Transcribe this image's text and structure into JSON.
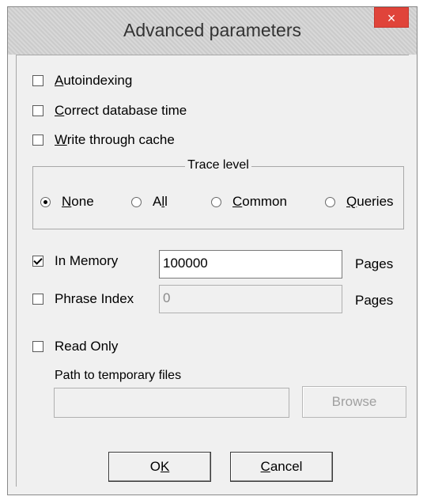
{
  "window": {
    "title": "Advanced parameters",
    "close_glyph": "×"
  },
  "options": {
    "autoindexing": {
      "label_u": "A",
      "label_rest": "utoindexing",
      "checked": false
    },
    "correct_time": {
      "label_u": "C",
      "label_rest": "orrect database time",
      "checked": false
    },
    "write_through": {
      "label_u": "W",
      "label_rest": "rite through cache",
      "checked": false
    }
  },
  "trace": {
    "title": "Trace level",
    "options": [
      {
        "u": "N",
        "rest": "one",
        "selected": true
      },
      {
        "pre": "A",
        "u": "l",
        "rest": "l",
        "selected": false
      },
      {
        "u": "C",
        "rest": "ommon",
        "selected": false
      },
      {
        "u": "Q",
        "rest": "ueries",
        "selected": false
      }
    ]
  },
  "memory": {
    "in_memory_label": "In Memory",
    "in_memory_checked": true,
    "in_memory_value": "100000",
    "phrase_index_label": "Phrase Index",
    "phrase_index_checked": false,
    "phrase_index_value": "0",
    "pages_label": "Pages"
  },
  "readonly": {
    "label": "Read Only",
    "checked": false,
    "path_label": "Path to temporary files",
    "path_value": "",
    "browse_label": "Browse"
  },
  "buttons": {
    "ok_pre": "O",
    "ok_u": "K",
    "cancel_u": "C",
    "cancel_rest": "ancel"
  }
}
